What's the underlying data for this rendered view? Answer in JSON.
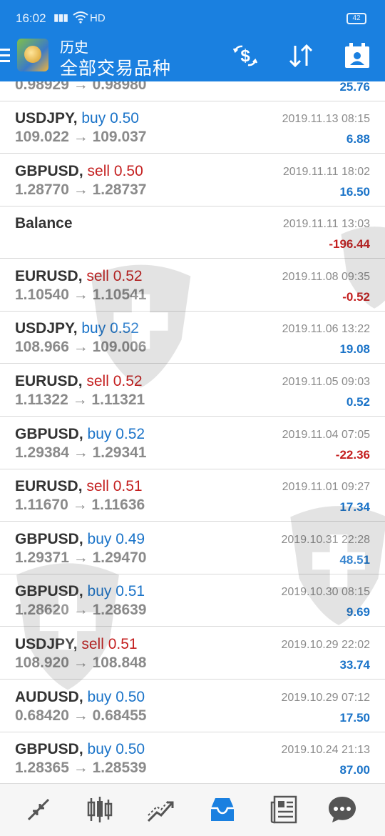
{
  "status_bar": {
    "time": "16:02",
    "signal": "4G",
    "network": "HD",
    "battery": "42"
  },
  "header": {
    "title": "历史",
    "subtitle": "全部交易品种",
    "icons": [
      "menu-icon",
      "app-logo",
      "currency-exchange-icon",
      "sort-icon",
      "calendar-person-icon"
    ]
  },
  "partial_row": {
    "prices": "0.98929 → 0.98980",
    "profit": "25.76"
  },
  "trades": [
    {
      "symbol": "USDJPY",
      "action": "buy 0.50",
      "side": "buy",
      "prices": "109.022 → 109.037",
      "date": "2019.11.13 08:15",
      "profit": "6.88",
      "sign": "pos"
    },
    {
      "symbol": "GBPUSD",
      "action": "sell 0.50",
      "side": "sell",
      "prices": "1.28770 → 1.28737",
      "date": "2019.11.11 18:02",
      "profit": "16.50",
      "sign": "pos"
    },
    {
      "symbol": "Balance",
      "action": "",
      "side": "none",
      "prices": "",
      "date": "2019.11.11 13:03",
      "profit": "-196.44",
      "sign": "neg"
    },
    {
      "symbol": "EURUSD",
      "action": "sell 0.52",
      "side": "sell",
      "prices": "1.10540 → 1.10541",
      "date": "2019.11.08 09:35",
      "profit": "-0.52",
      "sign": "neg"
    },
    {
      "symbol": "USDJPY",
      "action": "buy 0.52",
      "side": "buy",
      "prices": "108.966 → 109.006",
      "date": "2019.11.06 13:22",
      "profit": "19.08",
      "sign": "pos"
    },
    {
      "symbol": "EURUSD",
      "action": "sell 0.52",
      "side": "sell",
      "prices": "1.11322 → 1.11321",
      "date": "2019.11.05 09:03",
      "profit": "0.52",
      "sign": "pos"
    },
    {
      "symbol": "GBPUSD",
      "action": "buy 0.52",
      "side": "buy",
      "prices": "1.29384 → 1.29341",
      "date": "2019.11.04 07:05",
      "profit": "-22.36",
      "sign": "neg"
    },
    {
      "symbol": "EURUSD",
      "action": "sell 0.51",
      "side": "sell",
      "prices": "1.11670 → 1.11636",
      "date": "2019.11.01 09:27",
      "profit": "17.34",
      "sign": "pos"
    },
    {
      "symbol": "GBPUSD",
      "action": "buy 0.49",
      "side": "buy",
      "prices": "1.29371 → 1.29470",
      "date": "2019.10.31 22:28",
      "profit": "48.51",
      "sign": "pos"
    },
    {
      "symbol": "GBPUSD",
      "action": "buy 0.51",
      "side": "buy",
      "prices": "1.28620 → 1.28639",
      "date": "2019.10.30 08:15",
      "profit": "9.69",
      "sign": "pos"
    },
    {
      "symbol": "USDJPY",
      "action": "sell 0.51",
      "side": "sell",
      "prices": "108.920 → 108.848",
      "date": "2019.10.29 22:02",
      "profit": "33.74",
      "sign": "pos"
    },
    {
      "symbol": "AUDUSD",
      "action": "buy 0.50",
      "side": "buy",
      "prices": "0.68420 → 0.68455",
      "date": "2019.10.29 07:12",
      "profit": "17.50",
      "sign": "pos"
    },
    {
      "symbol": "GBPUSD",
      "action": "buy 0.50",
      "side": "buy",
      "prices": "1.28365 → 1.28539",
      "date": "2019.10.24 21:13",
      "profit": "87.00",
      "sign": "pos"
    }
  ],
  "bottom_nav": [
    {
      "name": "quotes-icon",
      "active": false
    },
    {
      "name": "chart-icon",
      "active": false
    },
    {
      "name": "trade-icon",
      "active": false
    },
    {
      "name": "history-icon",
      "active": true
    },
    {
      "name": "news-icon",
      "active": false
    },
    {
      "name": "messages-icon",
      "active": false
    }
  ],
  "colors": {
    "header": "#1a80e0",
    "buy": "#1a73c8",
    "sell": "#c41f1f",
    "text_gray": "#8a8a8a",
    "nav_active": "#1a80e0",
    "nav_inactive": "#555555"
  }
}
